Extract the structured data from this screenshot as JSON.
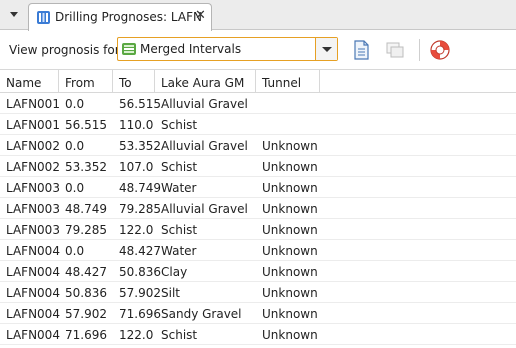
{
  "tab": {
    "title": "Drilling Prognoses: LAFN",
    "close_glyph": "✕"
  },
  "toolbar": {
    "view_label": "View prognosis for:",
    "selected_option": "Merged Intervals"
  },
  "table": {
    "columns": [
      "Name",
      "From",
      "To",
      "Lake Aura GM",
      "Tunnel"
    ],
    "rows": [
      [
        "LAFN001",
        "0.0",
        "56.515",
        "Alluvial Gravel",
        ""
      ],
      [
        "LAFN001",
        "56.515",
        "110.0",
        "Schist",
        ""
      ],
      [
        "LAFN002",
        "0.0",
        "53.352",
        "Alluvial Gravel",
        "Unknown"
      ],
      [
        "LAFN002",
        "53.352",
        "107.0",
        "Schist",
        "Unknown"
      ],
      [
        "LAFN003",
        "0.0",
        "48.749",
        "Water",
        "Unknown"
      ],
      [
        "LAFN003",
        "48.749",
        "79.285",
        "Alluvial Gravel",
        "Unknown"
      ],
      [
        "LAFN003",
        "79.285",
        "122.0",
        "Schist",
        "Unknown"
      ],
      [
        "LAFN004",
        "0.0",
        "48.427",
        "Water",
        "Unknown"
      ],
      [
        "LAFN004",
        "48.427",
        "50.836",
        "Clay",
        "Unknown"
      ],
      [
        "LAFN004",
        "50.836",
        "57.902",
        "Silt",
        "Unknown"
      ],
      [
        "LAFN004",
        "57.902",
        "71.696",
        "Sandy Gravel",
        "Unknown"
      ],
      [
        "LAFN004",
        "71.696",
        "122.0",
        "Schist",
        "Unknown"
      ]
    ]
  },
  "icons": {
    "tab": "drilling-prognosis-icon",
    "combo": "merged-intervals-icon",
    "toolbar": [
      "document-icon",
      "copy-disabled-icon",
      "help-lifebuoy-icon"
    ]
  },
  "colors": {
    "combo_border": "#e6a024",
    "tab_icon": "#3a7bd5"
  }
}
